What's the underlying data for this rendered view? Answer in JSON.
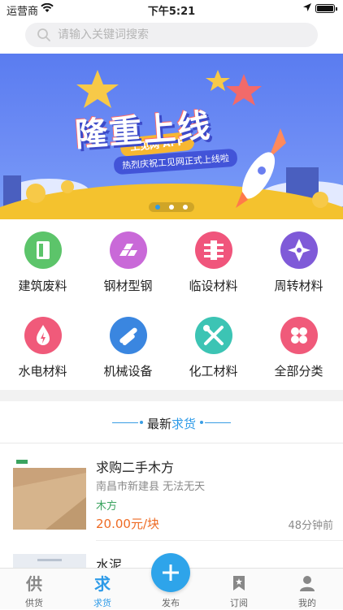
{
  "status_bar": {
    "carrier": "运营商",
    "time": "下午5:21"
  },
  "search": {
    "placeholder": "请输入关键词搜索"
  },
  "banner": {
    "app_tag": "工见网 APP",
    "headline": "隆重上线",
    "subline": "热烈庆祝工见网正式上线啦",
    "page_count": 3,
    "active_page": 1
  },
  "categories": [
    {
      "label": "建筑废料",
      "icon": "building-waste-icon",
      "color": "#5cc46a"
    },
    {
      "label": "钢材型钢",
      "icon": "steel-bar-icon",
      "color": "#c969d8"
    },
    {
      "label": "临设材料",
      "icon": "temp-facility-icon",
      "color": "#f0557c"
    },
    {
      "label": "周转材料",
      "icon": "turnover-icon",
      "color": "#7f5ad8"
    },
    {
      "label": "水电材料",
      "icon": "water-electric-icon",
      "color": "#f05a7a"
    },
    {
      "label": "机械设备",
      "icon": "machinery-icon",
      "color": "#3a86e0"
    },
    {
      "label": "化工材料",
      "icon": "chemical-tools-icon",
      "color": "#3cc4b4"
    },
    {
      "label": "全部分类",
      "icon": "all-categories-icon",
      "color": "#f05a7a"
    }
  ],
  "section": {
    "prefix": "最新",
    "accent": "求货"
  },
  "listings": [
    {
      "title": "求购二手木方",
      "location": "南昌市新建县 无法无天",
      "kind": "木方",
      "price": "20.00元/块",
      "ago": "48分钟前"
    },
    {
      "title": "水泥"
    }
  ],
  "tabbar": {
    "tabs": [
      {
        "label": "供货",
        "glyph": "供",
        "active": false
      },
      {
        "label": "求货",
        "glyph": "求",
        "active": true
      },
      {
        "label": "发布",
        "active": false
      },
      {
        "label": "订阅",
        "active": false
      },
      {
        "label": "我的",
        "active": false
      }
    ]
  },
  "colors": {
    "accent": "#2e9be8",
    "price": "#ee6b24",
    "kind": "#3aa35f"
  }
}
